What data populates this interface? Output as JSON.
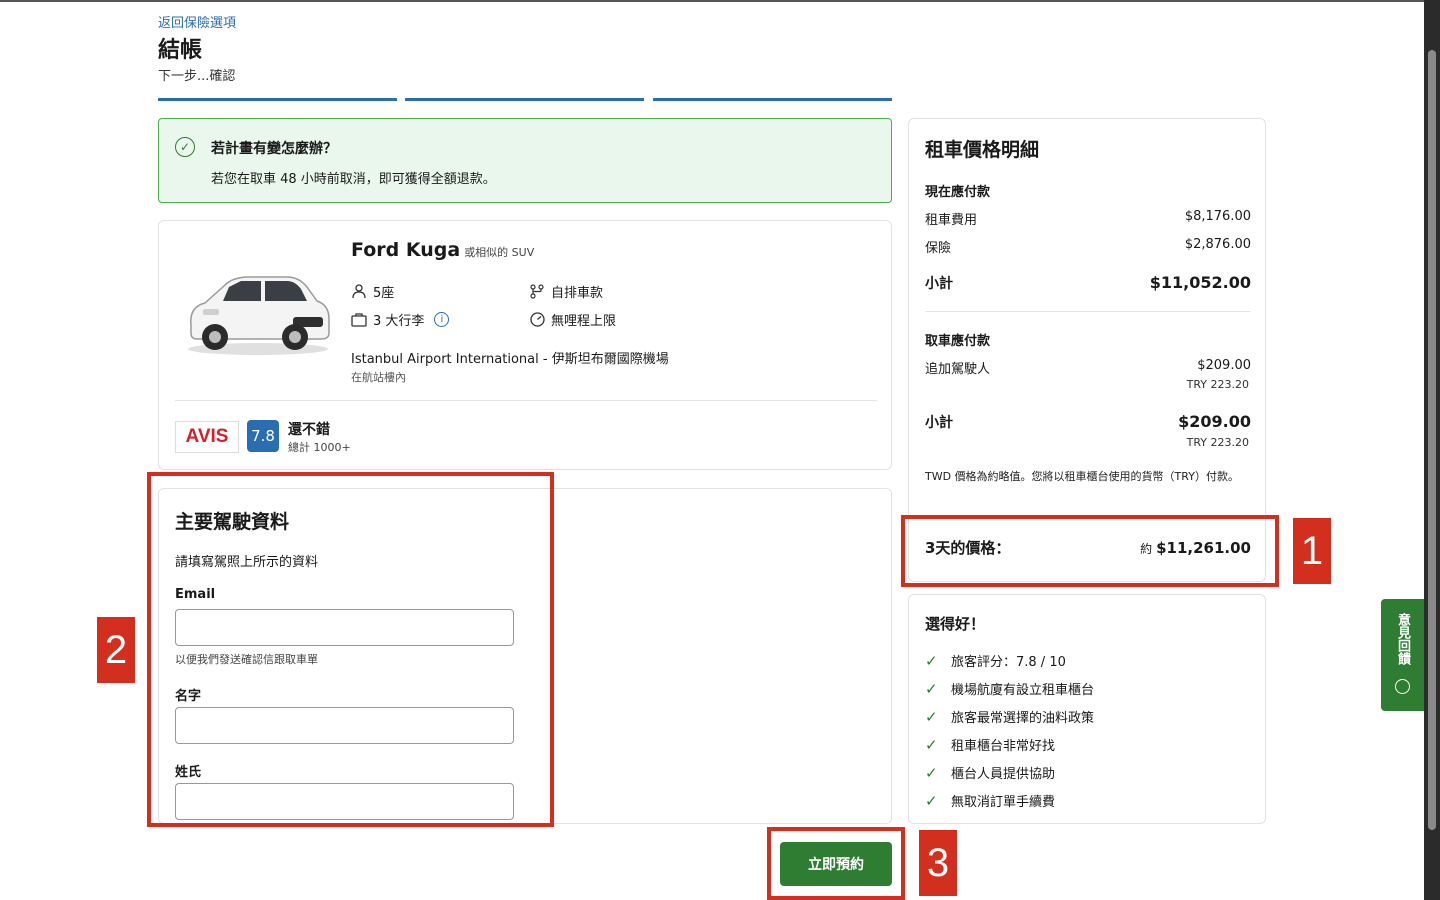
{
  "header": {
    "back_link": "返回保險選項",
    "title": "結帳",
    "subtitle": "下一步...確認"
  },
  "cancel_notice": {
    "title": "若計畫有變怎麼辦？",
    "text": "若您在取車 48 小時前取消，即可獲得全額退款。"
  },
  "car": {
    "name": "Ford Kuga",
    "similar": "或相似的 SUV",
    "seats": "5座",
    "bags": "3 大行李",
    "transmission": "自排車款",
    "mileage": "無哩程上限",
    "location": "Istanbul Airport International - 伊斯坦布爾國際機場",
    "location_sub": "在航站樓內",
    "supplier": "AVIS",
    "rating": "7.8",
    "rating_label": "還不錯",
    "rating_count": "總計 1000+"
  },
  "driver_form": {
    "title": "主要駕駛資料",
    "description": "請填寫駕照上所示的資料",
    "email_label": "Email",
    "email_hint": "以便我們發送確認信跟取車單",
    "first_name_label": "名字",
    "last_name_label": "姓氏"
  },
  "price": {
    "title": "租車價格明細",
    "pay_now_label": "現在應付款",
    "rental_label": "租車費用",
    "rental_amount": "$8,176.00",
    "insurance_label": "保險",
    "insurance_amount": "$2,876.00",
    "subtotal_label": "小計",
    "subtotal_amount": "$11,052.00",
    "pay_pickup_label": "取車應付款",
    "extra_driver_label": "追加駕駛人",
    "extra_driver_amount": "$209.00",
    "extra_driver_try": "TRY 223.20",
    "subtotal2_label": "小計",
    "subtotal2_amount": "$209.00",
    "subtotal2_try": "TRY 223.20",
    "note": "TWD 價格為約略值。您將以租車櫃台使用的貨幣（TRY）付款。",
    "total_label": "3天的價格：",
    "total_approx": "約",
    "total_amount": "$11,261.00"
  },
  "good_choice": {
    "title": "選得好！",
    "items": [
      "旅客評分：7.8 / 10",
      "機場航廈有設立租車櫃台",
      "旅客最常選擇的油料政策",
      "租車櫃台非常好找",
      "櫃台人員提供協助",
      "無取消訂單手續費"
    ]
  },
  "book_button": "立即預約",
  "feedback": "意見回饋",
  "annotations": [
    "1",
    "2",
    "3"
  ],
  "colors": {
    "accent_blue": "#2a6db0",
    "green": "#2e7d32",
    "annotation_red": "#d32f1f"
  }
}
